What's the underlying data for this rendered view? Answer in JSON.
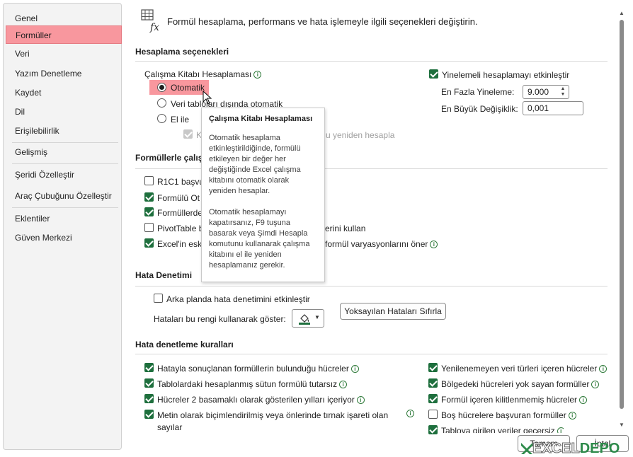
{
  "sidebar": {
    "items": [
      {
        "label": "Genel"
      },
      {
        "label": "Formüller"
      },
      {
        "label": "Veri"
      },
      {
        "label": "Yazım Denetleme"
      },
      {
        "label": "Kaydet"
      },
      {
        "label": "Dil"
      },
      {
        "label": "Erişilebilirlik"
      },
      {
        "label": "Gelişmiş"
      },
      {
        "label": "Şeridi Özelleştir"
      },
      {
        "label": "Araç Çubuğunu Özelleştir"
      },
      {
        "label": "Eklentiler"
      },
      {
        "label": "Güven Merkezi"
      }
    ],
    "active_index": 1
  },
  "header": {
    "text": "Formül hesaplama, performans ve hata işlemeyle ilgili seçenekleri değiştirin."
  },
  "calc": {
    "title": "Hesaplama seçenekleri",
    "workbook_label": "Çalışma Kitabı Hesaplaması",
    "auto": "Otomatik",
    "auto_except": "Veri tabloları dışında otomatik",
    "manual": "El ile",
    "recalc_prefix": "K",
    "recalc_suffix": "u yeniden hesapla",
    "iterative": "Yinelemeli hesaplamayı etkinleştir",
    "max_iter_label": "En Fazla Yineleme:",
    "max_iter_value": "9.000",
    "max_change_label": "En Büyük Değişiklik:",
    "max_change_value": "0,001"
  },
  "formulas": {
    "title_partial": "Formüllerle çalış",
    "r1c1": "R1C1 başvu",
    "autocomplete": "Formülü Ot",
    "table_names": "Formüllerde",
    "pivot": "PivotTable b",
    "pivot_suffix": "erini kullan",
    "legacy": "Excel'in esk",
    "legacy_suffix": "formül varyasyonlarını öner"
  },
  "error_check": {
    "title": "Hata Denetimi",
    "background": "Arka planda hata denetimini etkinleştir",
    "color_label": "Hataları bu rengi kullanarak göster:",
    "reset_button": "Yoksayılan Hataları Sıfırla"
  },
  "rules": {
    "title": "Hata denetleme kuralları",
    "left": [
      "Hatayla sonuçlanan formüllerin bulunduğu hücreler",
      "Tablolardaki hesaplanmış sütun formülü tutarsız",
      "Hücreler 2 basamaklı olarak gösterilen yılları içeriyor",
      "Metin olarak biçimlendirilmiş veya önlerinde tırnak işareti olan",
      "sayılar"
    ],
    "right": [
      "Yenilenemeyen veri türleri içeren hücreler",
      "Bölgedeki hücreleri yok sayan formüller",
      "Formül içeren kilitlenmemiş hücreler",
      "Boş hücrelere başvuran formüller",
      "Tabloya girilen veriler geçersiz"
    ]
  },
  "tooltip": {
    "title": "Çalışma Kitabı Hesaplaması",
    "p1": "Otomatik hesaplama etkinleştirildiğinde, formülü etkileyen bir değer her değiştiğinde Excel çalışma kitabını otomatik olarak yeniden hesaplar.",
    "p2": "Otomatik hesaplamayı kapatırsanız, F9 tuşuna basarak veya Şimdi Hesapla komutunu kullanarak çalışma kitabını el ile yeniden hesaplamanız gerekir."
  },
  "footer": {
    "ok": "Tamam",
    "cancel": "İptal"
  },
  "watermark": {
    "a": "EXCEL",
    "b": "DEPO"
  },
  "colors": {
    "accent": "#1e6f3d",
    "highlight": "#f8979e"
  }
}
